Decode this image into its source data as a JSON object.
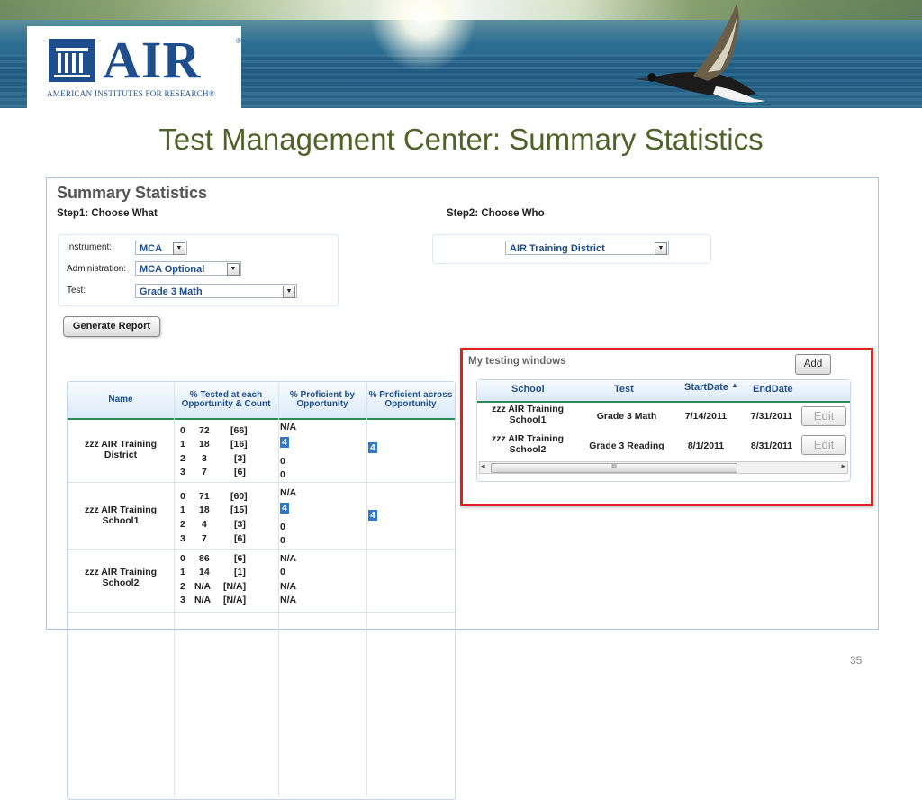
{
  "logo": {
    "main": "AIR",
    "registered": "®",
    "subtitle": "AMERICAN INSTITUTES FOR RESEARCH®"
  },
  "slide_title": "Test Management Center: Summary Statistics",
  "page_number": "35",
  "summary": {
    "heading": "Summary Statistics",
    "step1": "Step1: Choose What",
    "step2": "Step2: Choose Who",
    "fields": {
      "instrument_label": "Instrument:",
      "instrument_value": "MCA",
      "administration_label": "Administration:",
      "administration_value": "MCA Optional",
      "test_label": "Test:",
      "test_value": "Grade 3 Math",
      "who_value": "AIR Training District"
    },
    "generate_button": "Generate Report"
  },
  "stats_table": {
    "headers": {
      "name": "Name",
      "tested": "% Tested at each Opportunity & Count",
      "prof_by_opp": "% Proficient by Opportunity",
      "prof_across": "% Proficient across Opportunity"
    },
    "rows": [
      {
        "name": "zzz AIR Training District",
        "lines": [
          {
            "opp": "0",
            "pct": "72",
            "count": "[66]",
            "prof": "N/A"
          },
          {
            "opp": "1",
            "pct": "18",
            "count": "[16]",
            "prof": "4"
          },
          {
            "opp": "2",
            "pct": "3",
            "count": "[3]",
            "prof": "0"
          },
          {
            "opp": "3",
            "pct": "7",
            "count": "[6]",
            "prof": "0"
          }
        ],
        "across": "4"
      },
      {
        "name": "zzz AIR Training School1",
        "lines": [
          {
            "opp": "0",
            "pct": "71",
            "count": "[60]",
            "prof": "N/A"
          },
          {
            "opp": "1",
            "pct": "18",
            "count": "[15]",
            "prof": "4"
          },
          {
            "opp": "2",
            "pct": "4",
            "count": "[3]",
            "prof": "0"
          },
          {
            "opp": "3",
            "pct": "7",
            "count": "[6]",
            "prof": "0"
          }
        ],
        "across": "4"
      },
      {
        "name": "zzz AIR Training School2",
        "lines": [
          {
            "opp": "0",
            "pct": "86",
            "count": "[6]",
            "prof": "N/A"
          },
          {
            "opp": "1",
            "pct": "14",
            "count": "[1]",
            "prof": "0"
          },
          {
            "opp": "2",
            "pct": "N/A",
            "count": "[N/A]",
            "prof": "N/A"
          },
          {
            "opp": "3",
            "pct": "N/A",
            "count": "[N/A]",
            "prof": "N/A"
          }
        ],
        "across": ""
      }
    ]
  },
  "testing_windows": {
    "title": "My testing windows",
    "add_button": "Add",
    "headers": {
      "school": "School",
      "test": "Test",
      "start": "StartDate",
      "sort_indicator": "▲",
      "end": "EndDate"
    },
    "rows": [
      {
        "school": "zzz AIR Training School1",
        "test": "Grade 3 Math",
        "start": "7/14/2011",
        "end": "7/31/2011",
        "action": "Edit"
      },
      {
        "school": "zzz AIR Training School2",
        "test": "Grade 3 Reading",
        "start": "8/1/2011",
        "end": "8/31/2011",
        "action": "Edit"
      }
    ],
    "scroll_left": "◂",
    "scroll_right": "▸",
    "scroll_grip": "III"
  }
}
